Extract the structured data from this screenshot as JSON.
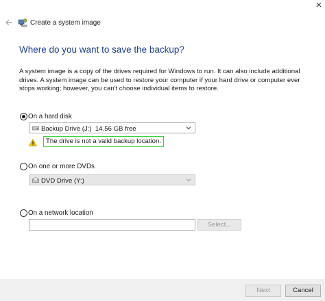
{
  "window": {
    "title": "Create a system image",
    "close_glyph": "×"
  },
  "heading": "Where do you want to save the backup?",
  "description": "A system image is a copy of the drives required for Windows to run. It can also include additional drives. A system image can be used to restore your computer if your hard drive or computer ever stops working; however, you can't choose individual items to restore.",
  "options": {
    "hard_disk": {
      "label": "On a hard disk",
      "selected": true,
      "dropdown_value": "Backup Drive (J:)  14.56 GB free",
      "warning": "The drive is not a valid backup location."
    },
    "dvd": {
      "label": "On one or more DVDs",
      "selected": false,
      "dropdown_value": "DVD Drive (Y:)"
    },
    "network": {
      "label": "On a network location",
      "selected": false,
      "input_value": "",
      "select_label": "Select..."
    }
  },
  "footer": {
    "next_label": "Next",
    "cancel_label": "Cancel"
  },
  "colors": {
    "heading": "#1e3f8a",
    "warning_highlight": "#3cd33c",
    "footer_bg": "#f0f0f0"
  },
  "icons": {
    "back": "back-arrow-icon",
    "app": "system-image-icon",
    "drive": "drive-icon",
    "dvd": "dvd-drive-icon",
    "warning": "warning-icon",
    "dropdown": "chevron-down-icon"
  }
}
